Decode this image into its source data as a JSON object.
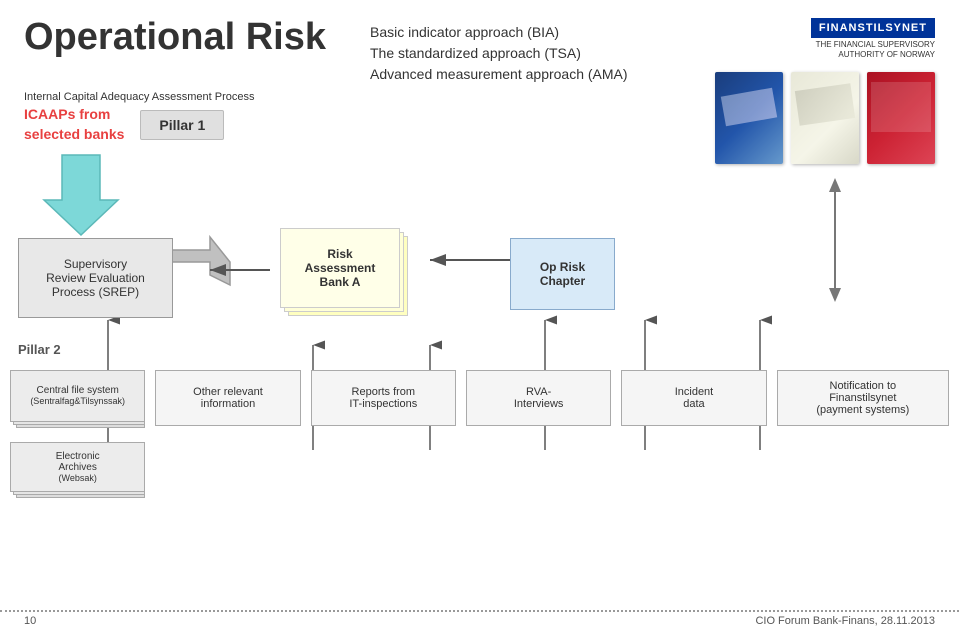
{
  "header": {
    "title": "Operational Risk",
    "approach1": "Basic indicator approach (BIA)",
    "approach2": "The standardized approach (TSA)",
    "approach3": "Advanced measurement approach (AMA)",
    "logo_name": "FINANSTILSYNET",
    "logo_sub1": "THE FINANCIAL SUPERVISORY",
    "logo_sub2": "AUTHORITY OF NORWAY"
  },
  "internal_capital": "Internal Capital Adequacy Assessment Process",
  "icaap": {
    "label": "ICAAPs from\nselected banks"
  },
  "pillar1": {
    "label": "Pillar 1"
  },
  "srep": {
    "label": "Supervisory\nReview Evaluation\nProcess (SREP)"
  },
  "risk_assessment": {
    "label": "Risk\nAssessment\nBank A"
  },
  "op_risk": {
    "label": "Op Risk\nChapter"
  },
  "pillar2": {
    "label": "Pillar 2"
  },
  "bottom_boxes": [
    {
      "id": "central-file",
      "label": "Central file system\n(Sentralfag&Tilsynssak)",
      "sub_label": "Electronic\nArchives\n(Websak)",
      "stacked": true
    },
    {
      "id": "other-relevant",
      "label": "Other relevant\ninformation",
      "stacked": false
    },
    {
      "id": "reports-it",
      "label": "Reports from\nIT-inspections",
      "stacked": false
    },
    {
      "id": "rva",
      "label": "RVA-\nInterviews",
      "stacked": false
    },
    {
      "id": "incident",
      "label": "Incident\ndata",
      "stacked": false
    },
    {
      "id": "notification",
      "label": "Notification to\nFinanstilsynet\n(payment systems)",
      "stacked": false
    }
  ],
  "footer": {
    "page": "10",
    "credit": "CIO Forum Bank-Finans, 28.11.2013"
  }
}
